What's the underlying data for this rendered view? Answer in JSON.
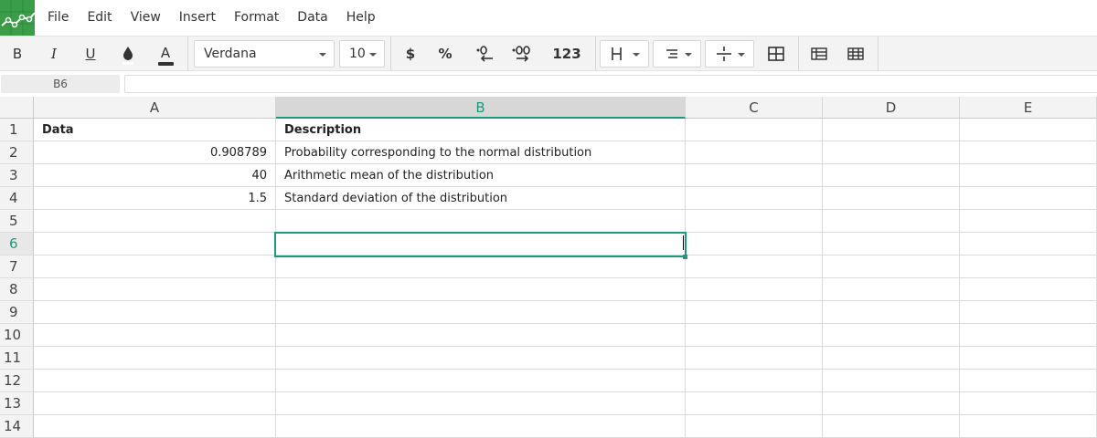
{
  "menu": {
    "items": [
      "File",
      "Edit",
      "View",
      "Insert",
      "Format",
      "Data",
      "Help"
    ]
  },
  "toolbar": {
    "bold": "B",
    "italic": "I",
    "underline": "U",
    "text_color": "A",
    "font_family": "Verdana",
    "font_size": "10",
    "currency": "$",
    "percent": "%",
    "decrease_decimals": ".0",
    "increase_decimals": ".00",
    "number_format": "123"
  },
  "formula_bar": {
    "cell_ref": "B6",
    "value": ""
  },
  "columns": [
    "A",
    "B",
    "C",
    "D",
    "E"
  ],
  "active_column": "B",
  "rows": [
    "1",
    "2",
    "3",
    "4",
    "5",
    "6",
    "7",
    "8",
    "9",
    "10",
    "11",
    "12",
    "13",
    "14"
  ],
  "active_row": "6",
  "cells": {
    "A1": "Data",
    "B1": "Description",
    "A2": "0.908789",
    "B2": "Probability corresponding to the normal distribution",
    "A3": "40",
    "B3": "Arithmetic mean of the distribution",
    "A4": "1.5",
    "B4": "Standard deviation of the distribution"
  },
  "colors": {
    "accent": "#1c9a7e",
    "logo": "#3a9e48"
  }
}
